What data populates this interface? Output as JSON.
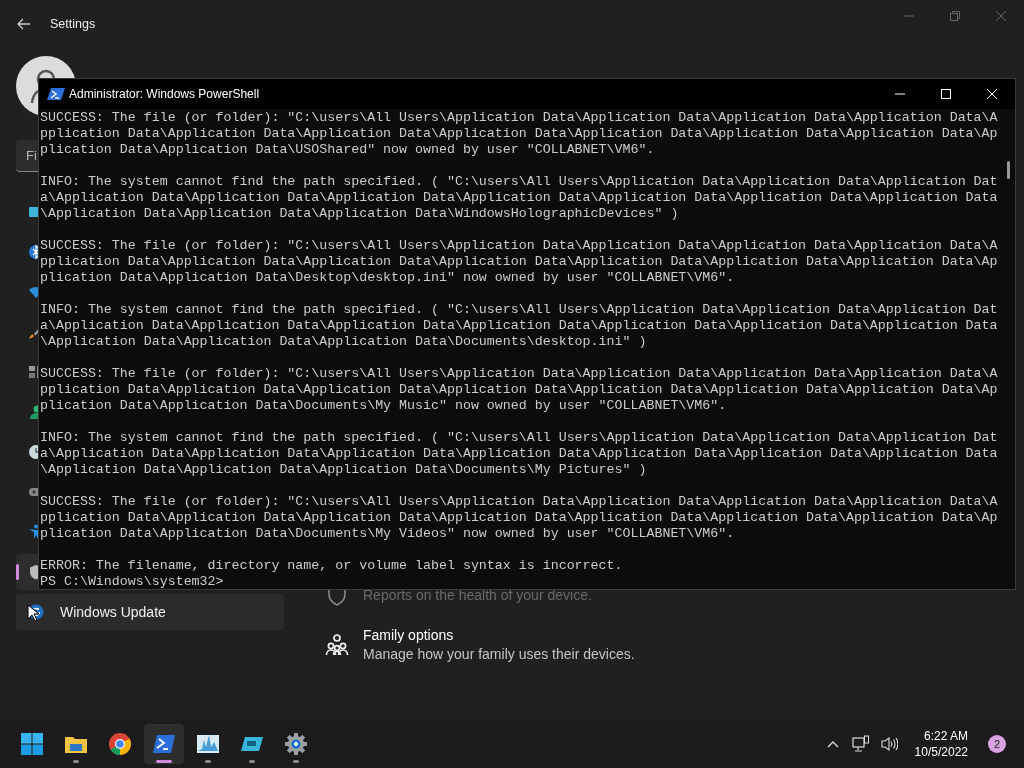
{
  "settings": {
    "title": "Settings",
    "search": {
      "placeholder": "Fi"
    },
    "sidebar": {
      "items": [
        {
          "kind": "display",
          "selected": false
        },
        {
          "kind": "bluetooth",
          "selected": false
        },
        {
          "kind": "wifi",
          "selected": false
        },
        {
          "kind": "brush",
          "selected": false
        },
        {
          "kind": "apps",
          "selected": false
        },
        {
          "kind": "person",
          "selected": false
        },
        {
          "kind": "clock",
          "selected": false
        },
        {
          "kind": "gamepad",
          "selected": false
        },
        {
          "kind": "accessibility",
          "selected": false
        },
        {
          "kind": "shield",
          "selected": true
        },
        {
          "kind": "update",
          "label": "Windows Update",
          "selected": false
        }
      ]
    },
    "items": [
      {
        "kind": "shield",
        "description": "Reports on the health of your device."
      },
      {
        "kind": "family",
        "title": "Family options",
        "description": "Manage how your family uses their devices."
      }
    ]
  },
  "console": {
    "title": "Administrator: Windows PowerShell",
    "blocks": [
      {
        "lines": [
          "SUCCESS: The file (or folder): \"C:\\users\\All Users\\Application Data\\Application Data\\Application Data\\Application Data\\A",
          "pplication Data\\Application Data\\Application Data\\Application Data\\Application Data\\Application Data\\Application Data\\Ap",
          "plication Data\\Application Data\\USOShared\" now owned by user \"COLLABNET\\VM6\"."
        ]
      },
      {
        "lines": [
          "INFO: The system cannot find the path specified. ( \"C:\\users\\All Users\\Application Data\\Application Data\\Application Dat",
          "a\\Application Data\\Application Data\\Application Data\\Application Data\\Application Data\\Application Data\\Application Data",
          "\\Application Data\\Application Data\\Application Data\\WindowsHolographicDevices\" )"
        ]
      },
      {
        "lines": [
          "SUCCESS: The file (or folder): \"C:\\users\\All Users\\Application Data\\Application Data\\Application Data\\Application Data\\A",
          "pplication Data\\Application Data\\Application Data\\Application Data\\Application Data\\Application Data\\Application Data\\Ap",
          "plication Data\\Application Data\\Desktop\\desktop.ini\" now owned by user \"COLLABNET\\VM6\"."
        ]
      },
      {
        "lines": [
          "INFO: The system cannot find the path specified. ( \"C:\\users\\All Users\\Application Data\\Application Data\\Application Dat",
          "a\\Application Data\\Application Data\\Application Data\\Application Data\\Application Data\\Application Data\\Application Data",
          "\\Application Data\\Application Data\\Application Data\\Documents\\desktop.ini\" )"
        ]
      },
      {
        "lines": [
          "SUCCESS: The file (or folder): \"C:\\users\\All Users\\Application Data\\Application Data\\Application Data\\Application Data\\A",
          "pplication Data\\Application Data\\Application Data\\Application Data\\Application Data\\Application Data\\Application Data\\Ap",
          "plication Data\\Application Data\\Documents\\My Music\" now owned by user \"COLLABNET\\VM6\"."
        ]
      },
      {
        "lines": [
          "INFO: The system cannot find the path specified. ( \"C:\\users\\All Users\\Application Data\\Application Data\\Application Dat",
          "a\\Application Data\\Application Data\\Application Data\\Application Data\\Application Data\\Application Data\\Application Data",
          "\\Application Data\\Application Data\\Application Data\\Documents\\My Pictures\" )"
        ]
      },
      {
        "lines": [
          "SUCCESS: The file (or folder): \"C:\\users\\All Users\\Application Data\\Application Data\\Application Data\\Application Data\\A",
          "pplication Data\\Application Data\\Application Data\\Application Data\\Application Data\\Application Data\\Application Data\\Ap",
          "plication Data\\Application Data\\Documents\\My Videos\" now owned by user \"COLLABNET\\VM6\"."
        ]
      },
      {
        "lines": [
          "ERROR: The filename, directory name, or volume label syntax is incorrect.",
          "PS C:\\Windows\\system32>"
        ]
      }
    ]
  },
  "taskbar": {
    "apps": [
      {
        "kind": "start",
        "running": false,
        "selected": false
      },
      {
        "kind": "folder",
        "running": true,
        "selected": false
      },
      {
        "kind": "chrome",
        "running": false,
        "selected": false
      },
      {
        "kind": "powershell",
        "running": true,
        "selected": true
      },
      {
        "kind": "monitor",
        "running": true,
        "selected": false
      },
      {
        "kind": "tablet",
        "running": true,
        "selected": false
      },
      {
        "kind": "gear",
        "running": true,
        "selected": false
      }
    ],
    "tray": {
      "time": "6:22 AM",
      "date": "10/5/2022",
      "notifications": "2"
    }
  }
}
